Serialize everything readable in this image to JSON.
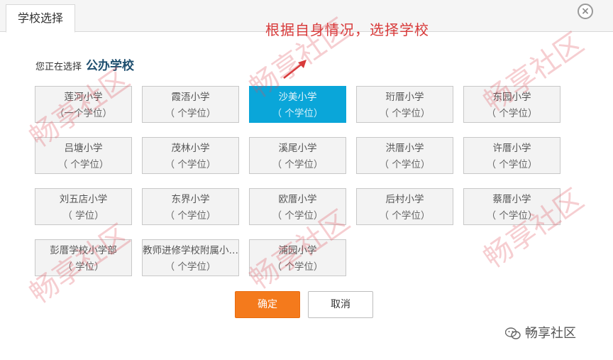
{
  "dialog": {
    "tab_label": "学校选择",
    "close_glyph": "×",
    "annotation": "根据自身情况，选择学校",
    "choosing_prefix": "您正在选择",
    "choosing_type": "公办学校",
    "confirm_label": "确定",
    "cancel_label": "取消",
    "accent_color": "#0aa6d9",
    "confirm_color": "#f47a1c"
  },
  "schools": [
    {
      "name": "莲河小学",
      "seats": "（一个学位）"
    },
    {
      "name": "霞浯小学",
      "seats": "（ 个学位）"
    },
    {
      "name": "沙美小学",
      "seats": "（ 个学位）",
      "selected": true
    },
    {
      "name": "珩厝小学",
      "seats": "（ 个学位）"
    },
    {
      "name": "东园小学",
      "seats": "（ 个学位）"
    },
    {
      "name": "吕塘小学",
      "seats": "（ 个学位）"
    },
    {
      "name": "茂林小学",
      "seats": "（ 个学位）"
    },
    {
      "name": "溪尾小学",
      "seats": "（ 个学位）"
    },
    {
      "name": "洪厝小学",
      "seats": "（ 个学位）"
    },
    {
      "name": "许厝小学",
      "seats": "（ 个学位）"
    },
    {
      "name": "刘五店小学",
      "seats": "（ 学位）"
    },
    {
      "name": "东界小学",
      "seats": "（ 个学位）"
    },
    {
      "name": "欧厝小学",
      "seats": "（ 个学位）"
    },
    {
      "name": "后村小学",
      "seats": "（ 个学位）"
    },
    {
      "name": "蔡厝小学",
      "seats": "（ 个学位）"
    },
    {
      "name": "彭厝学校小学部",
      "seats": "（ 学位）"
    },
    {
      "name": "教师进修学校附属小…",
      "seats": "（ 个学位）"
    },
    {
      "name": "浦园小学",
      "seats": "（ 个学位）"
    }
  ],
  "watermark": {
    "text": "畅享社区",
    "logo_text": "畅享社区",
    "logo_icon": "wechat-icon"
  }
}
